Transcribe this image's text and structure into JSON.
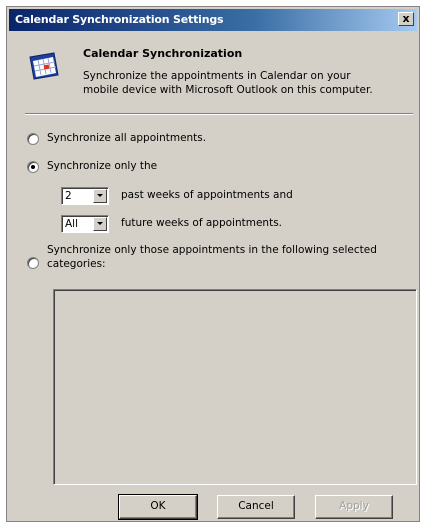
{
  "window": {
    "title": "Calendar Synchronization Settings",
    "close_glyph": "x"
  },
  "header": {
    "icon": "calendar-icon",
    "title": "Calendar Synchronization",
    "description": "Synchronize the appointments in Calendar on your mobile device with Microsoft Outlook on this computer."
  },
  "options": {
    "all_label": "Synchronize all appointments.",
    "only_label": "Synchronize only the",
    "past_value": "2",
    "past_label": "past weeks of appointments and",
    "future_value": "All",
    "future_label": "future weeks of appointments.",
    "categories_label_line1": "Synchronize only those appointments in the following selected",
    "categories_label_line2": "categories:",
    "selected": "only"
  },
  "buttons": {
    "ok": "OK",
    "cancel": "Cancel",
    "apply": "Apply"
  }
}
